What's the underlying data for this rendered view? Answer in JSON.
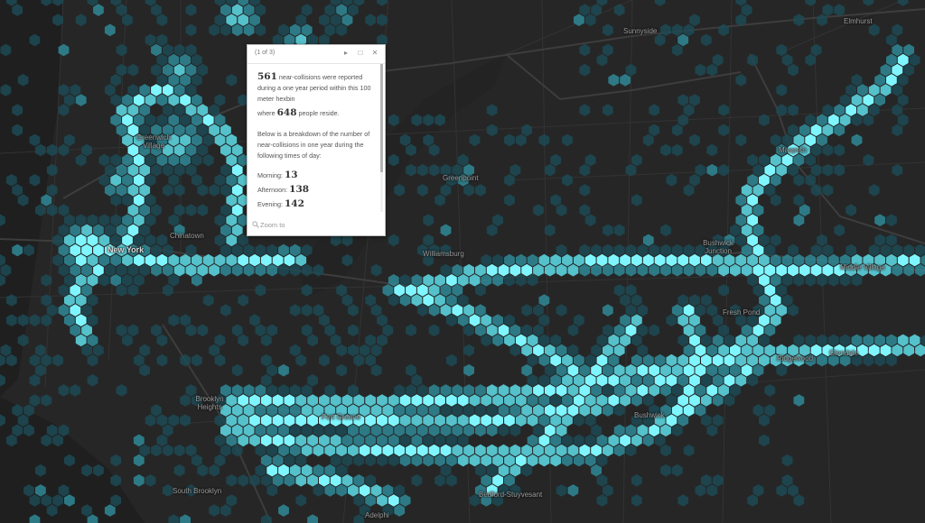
{
  "map": {
    "colors": {
      "background": "#262626",
      "streets_major": "#3b3b3b",
      "streets_minor": "#303030",
      "water": "#1f1f1f",
      "hex_low": "#1d4a55",
      "hex_mid": "#2f8a98",
      "hex_high": "#57c9d4",
      "hex_max": "#7ff6ff"
    },
    "labels": [
      {
        "id": "sunnyside",
        "text": "Sunnyside",
        "major": false
      },
      {
        "id": "elmhurst",
        "text": "Elmhurst",
        "major": false
      },
      {
        "id": "greenwich-village",
        "text": "Greenwich Village",
        "major": false
      },
      {
        "id": "maspeth",
        "text": "Maspeth",
        "major": false
      },
      {
        "id": "greenpoint",
        "text": "Greenpoint",
        "major": false
      },
      {
        "id": "chinatown",
        "text": "Chinatown",
        "major": false
      },
      {
        "id": "new-york",
        "text": "New York",
        "major": true
      },
      {
        "id": "williamsburg",
        "text": "Williamsburg",
        "major": false
      },
      {
        "id": "bushwick-junction",
        "text": "Bushwick Junction",
        "major": false
      },
      {
        "id": "middle-village",
        "text": "Middle Village",
        "major": false
      },
      {
        "id": "fresh-pond",
        "text": "Fresh Pond",
        "major": false
      },
      {
        "id": "ridgewood",
        "text": "Ridgewood",
        "major": false
      },
      {
        "id": "glendale",
        "text": "Glendale",
        "major": false
      },
      {
        "id": "brooklyn-heights",
        "text": "Brooklyn Heights",
        "major": false
      },
      {
        "id": "fort-greene",
        "text": "Fort Greene",
        "major": false
      },
      {
        "id": "bushwick",
        "text": "Bushwick",
        "major": false
      },
      {
        "id": "south-brooklyn",
        "text": "South Brooklyn",
        "major": false
      },
      {
        "id": "bedford-stuyvesant",
        "text": "Bedford-Stuyvesant",
        "major": false
      },
      {
        "id": "adelphi",
        "text": "Adelphi",
        "major": false
      }
    ]
  },
  "popup": {
    "count": "(1 of 3)",
    "next_icon": "next-arrow-icon",
    "maximize_icon": "maximize-icon",
    "close_icon": "close-icon",
    "collisions": "561",
    "text1": "near-collisions were reported during a one year period within this 100 meter hexbin",
    "where": "where",
    "population": "648",
    "text2": "people reside.",
    "breakdown": "Below is a breakdown of the number of near-collisions in one year during the following times of day:",
    "rows": [
      {
        "label": "Morning:",
        "value": "13"
      },
      {
        "label": "Afternoon:",
        "value": "138"
      },
      {
        "label": "Evening:",
        "value": "142"
      }
    ],
    "zoom_icon": "zoom-magnifier-icon",
    "zoom_label": "Zoom to"
  }
}
